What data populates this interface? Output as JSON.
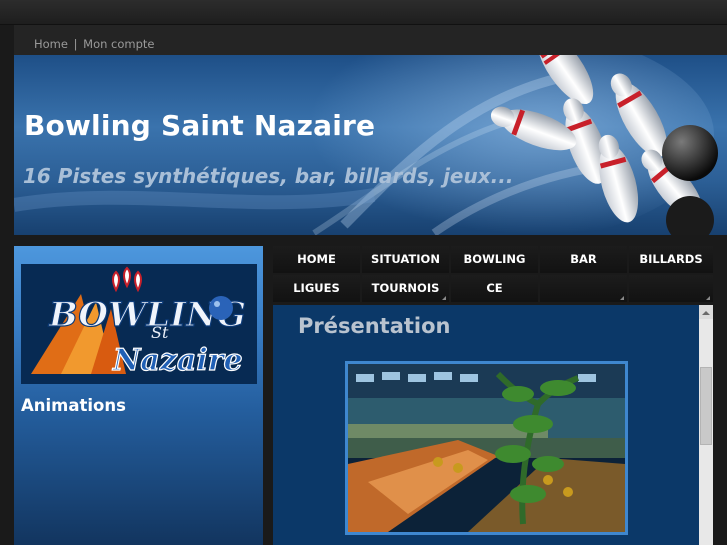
{
  "topnav": {
    "home": "Home",
    "separator": "|",
    "account": "Mon compte"
  },
  "banner": {
    "title": "Bowling Saint Nazaire",
    "subtitle": "16 Pistes synthétiques, bar, billards, jeux..."
  },
  "sidebar": {
    "heading": "Animations"
  },
  "nav": {
    "items": [
      "HOME",
      "SITUATION",
      "BOWLING",
      "BAR",
      "BILLARDS",
      "LIGUES",
      "TOURNOIS",
      "CE",
      "",
      ""
    ]
  },
  "content": {
    "title": "Présentation"
  },
  "colors": {
    "accent": "#3f87cf",
    "banner": "#2c5f96",
    "nav": "#161616"
  }
}
